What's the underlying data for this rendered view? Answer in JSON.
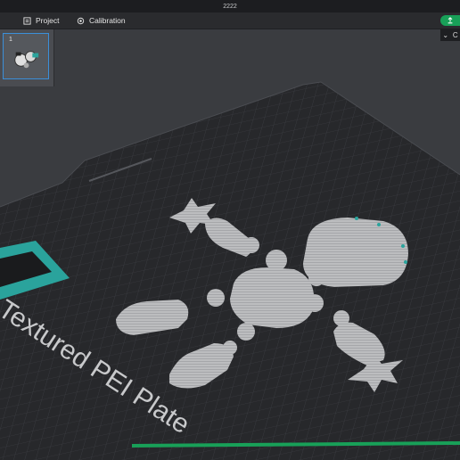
{
  "window": {
    "title": "2222"
  },
  "toolbar": {
    "tabs": [
      {
        "label": "Project",
        "icon": "project-icon"
      },
      {
        "label": "Calibration",
        "icon": "calibration-icon"
      }
    ],
    "right_button_icon": "upload-icon",
    "view_toggle_label": "C"
  },
  "plates": [
    {
      "number": "1"
    }
  ],
  "bed": {
    "label": "Textured PEI Plate",
    "bed_color": "#26272a",
    "grid_color": "#3a3c40",
    "part_color": "#b9babc",
    "accent_color": "#2aa39c",
    "progress_color": "#18a058"
  }
}
